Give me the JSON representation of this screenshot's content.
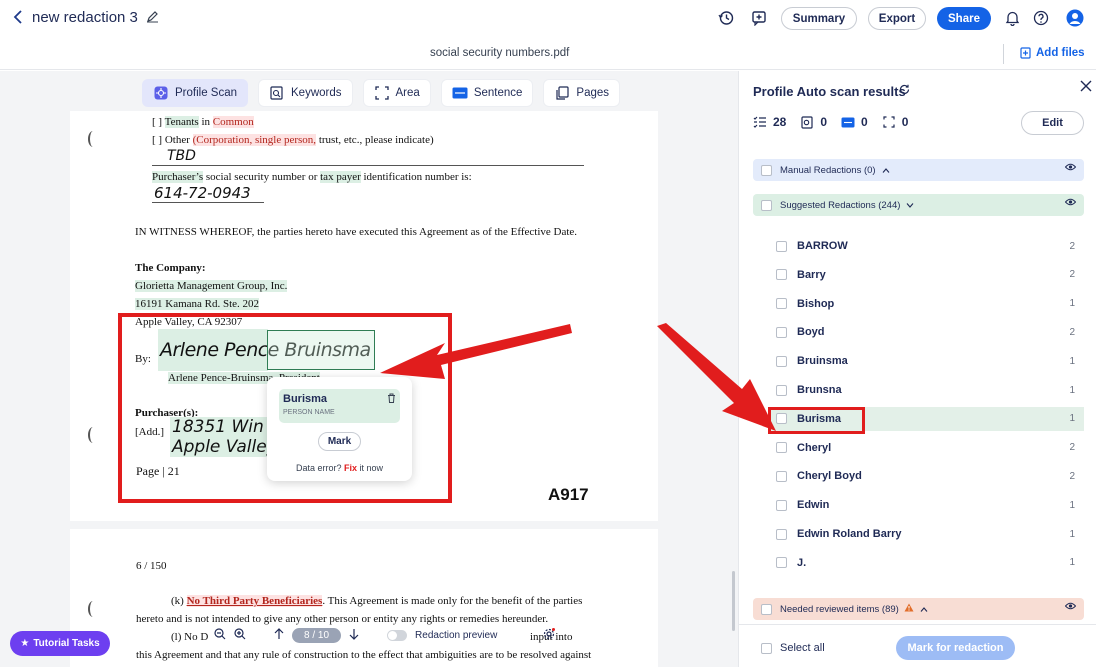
{
  "header": {
    "title": "new redaction 3",
    "summary_label": "Summary",
    "export_label": "Export",
    "share_label": "Share"
  },
  "filebar": {
    "filename": "social security numbers.pdf",
    "add_files_label": "Add files"
  },
  "tabs": [
    {
      "label": "Profile Scan",
      "active": true
    },
    {
      "label": "Keywords"
    },
    {
      "label": "Area"
    },
    {
      "label": "Sentence"
    },
    {
      "label": "Pages"
    }
  ],
  "document": {
    "page1": {
      "line1_prefix": "[ ] ",
      "line1_a": "Tenants",
      "line1_b": " in ",
      "line1_c": "Common",
      "line2_prefix": "[ ] Other ",
      "line2_hl": "(Corporation, single person,",
      "line2_rest": " trust, etc., please indicate)",
      "hand1": "TBD",
      "ssn_label_a": "Purchaser’s",
      "ssn_label_b": " social security number or ",
      "ssn_label_c": "tax payer",
      "ssn_label_d": " identification number is:",
      "hand_ssn": "614-72-0943",
      "witness": "IN WITNESS WHEREOF, the parties hereto have executed this Agreement as of the Effective Date.",
      "company_heading": "The Company:",
      "company_name": "Glorietta Management Group, Inc.",
      "company_addr1": "16191 Kamana Rd. Ste. 202",
      "company_addr2": "Apple Valley, CA 92307",
      "by_label": "By:",
      "signature": "Arlene Pence Bruinsma",
      "signer": "Arlene Pence-Bruinsma, President",
      "purchaser_heading": "Purchaser(s):",
      "add_label": "[Add.]",
      "hand_addr1": "18351 Win",
      "hand_addr2": "Apple Valley",
      "page_label": "Page | 21",
      "stamp": "A917"
    },
    "page2": {
      "page_count": "6 / 150",
      "para_k_num": "(k) ",
      "para_k_title": "No Third Party Beneficiaries",
      "para_k_rest": ". This Agreement is made only for the benefit of the parties",
      "para_k_line2": "hereto and is not intended to give any other person or entity any rights or remedies hereunder.",
      "para_l_start": "(l) No D",
      "para_l_end": "input into",
      "para_l_line2": "this Agreement and that any rule of construction to the effect that ambiguities are to be resolved against"
    }
  },
  "popup": {
    "name": "Burisma",
    "type": "PERSON NAME",
    "mark_label": "Mark",
    "error_text": "Data error? ",
    "fix_label": "Fix",
    "error_suffix": " it now"
  },
  "bottombar": {
    "pager": "8 / 10",
    "preview_label": "Redaction preview"
  },
  "tutorial_label": "Tutorial Tasks",
  "panel": {
    "title": "Profile Auto scan results",
    "stats": [
      "28",
      "0",
      "0",
      "0"
    ],
    "edit_label": "Edit",
    "manual_label": "Manual Redactions (0)",
    "suggested_label": "Suggested Redactions (244)",
    "needed_label": "Needed reviewed items (89)",
    "items": [
      {
        "name": "BARROW",
        "count": "2"
      },
      {
        "name": "Barry",
        "count": "2"
      },
      {
        "name": "Bishop",
        "count": "1"
      },
      {
        "name": "Boyd",
        "count": "2"
      },
      {
        "name": "Bruinsma",
        "count": "1"
      },
      {
        "name": "Brunsna",
        "count": "1"
      },
      {
        "name": "Burisma",
        "count": "1"
      },
      {
        "name": "Cheryl",
        "count": "2"
      },
      {
        "name": "Cheryl Boyd",
        "count": "2"
      },
      {
        "name": "Edwin",
        "count": "1"
      },
      {
        "name": "Edwin Roland Barry",
        "count": "1"
      },
      {
        "name": "J.",
        "count": "1"
      }
    ],
    "select_all_label": "Select all",
    "mark_button_label": "Mark for redaction"
  },
  "colors": {
    "accent": "#1463e6",
    "highlight_red": "#e11d1d",
    "tutorial": "#6d3ff0"
  }
}
